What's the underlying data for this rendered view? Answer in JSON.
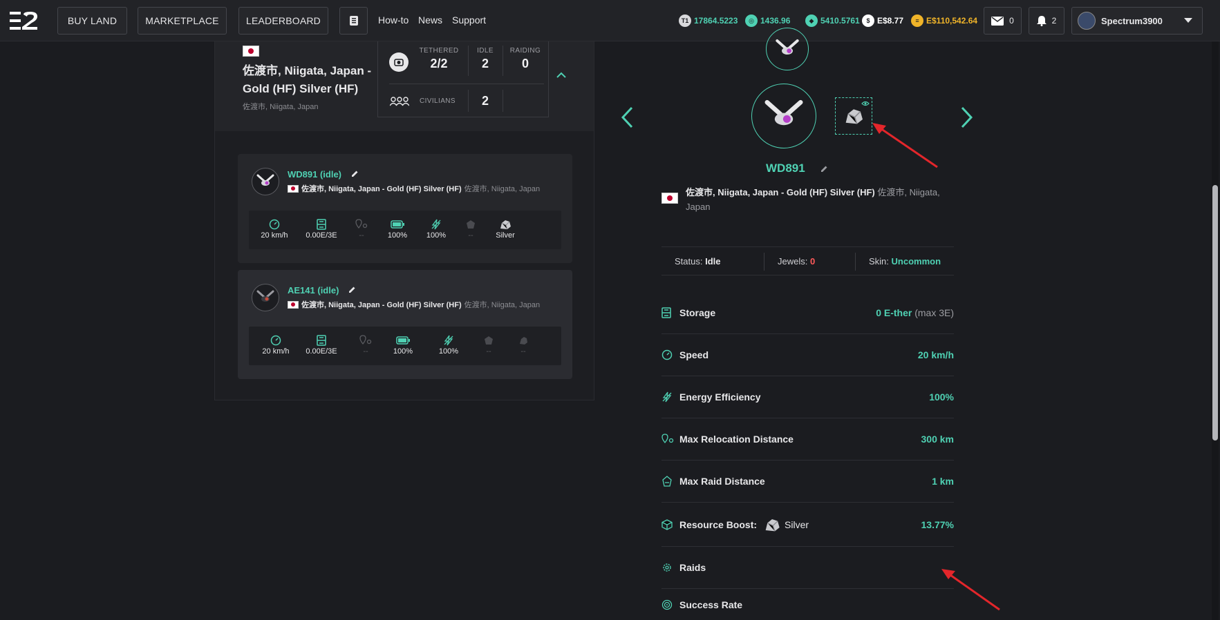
{
  "topbar": {
    "nav_buttons": [
      "BUY LAND",
      "MARKETPLACE",
      "LEADERBOARD"
    ],
    "links": [
      "How-to",
      "News",
      "Support"
    ],
    "balances": [
      {
        "value": "17864.5223",
        "color": "#4fd1b3"
      },
      {
        "value": "1436.96",
        "color": "#4fd1b3"
      },
      {
        "value": "5410.5761",
        "color": "#4fd1b3"
      },
      {
        "value": "E$8.77",
        "color": "#ffffff"
      },
      {
        "value": "E$110,542.64",
        "color": "#f0b429"
      }
    ],
    "mail_count": "0",
    "notif_count": "2",
    "username": "Spectrum3900"
  },
  "property": {
    "title": "佐渡市, Niigata, Japan - Gold (HF) Silver (HF)",
    "subtitle": "佐渡市, Niigata, Japan",
    "tethered_label": "TETHERED",
    "tethered_value": "2/2",
    "idle_label": "IDLE",
    "idle_value": "2",
    "raiding_label": "RAIDING",
    "raiding_value": "0",
    "civilians_label": "CIVILIANS",
    "civilians_value": "2"
  },
  "drones": [
    {
      "name": "WD891 (idle)",
      "location": "佐渡市, Niigata, Japan - Gold (HF) Silver (HF)",
      "location_sub": "佐渡市, Niigata, Japan",
      "stats": [
        "20 km/h",
        "0.00E/3E",
        "--",
        "100%",
        "100%",
        "--",
        "Silver"
      ]
    },
    {
      "name": "AE141 (idle)",
      "location": "佐渡市, Niigata, Japan - Gold (HF) Silver (HF)",
      "location_sub": "佐渡市, Niigata, Japan",
      "stats": [
        "20 km/h",
        "0.00E/3E",
        "--",
        "100%",
        "100%",
        "--",
        "--"
      ]
    }
  ],
  "detail": {
    "name": "WD891",
    "location": "佐渡市, Niigata, Japan - Gold (HF) Silver (HF)",
    "location_sub": "佐渡市, Niigata, Japan",
    "status_label": "Status:",
    "status_value": "Idle",
    "jewels_label": "Jewels:",
    "jewels_value": "0",
    "skin_label": "Skin:",
    "skin_value": "Uncommon",
    "rows": [
      {
        "label": "Storage",
        "value": "0 E-ther",
        "extra": "(max 3E)"
      },
      {
        "label": "Speed",
        "value": "20 km/h"
      },
      {
        "label": "Energy Efficiency",
        "value": "100%"
      },
      {
        "label": "Max Relocation Distance",
        "value": "300 km"
      },
      {
        "label": "Max Raid Distance",
        "value": "1 km"
      },
      {
        "label": "Resource Boost:",
        "resource": "Silver",
        "value": "13.77%"
      },
      {
        "label": "Raids",
        "value": ""
      },
      {
        "label": "Success Rate",
        "value": ""
      }
    ]
  }
}
